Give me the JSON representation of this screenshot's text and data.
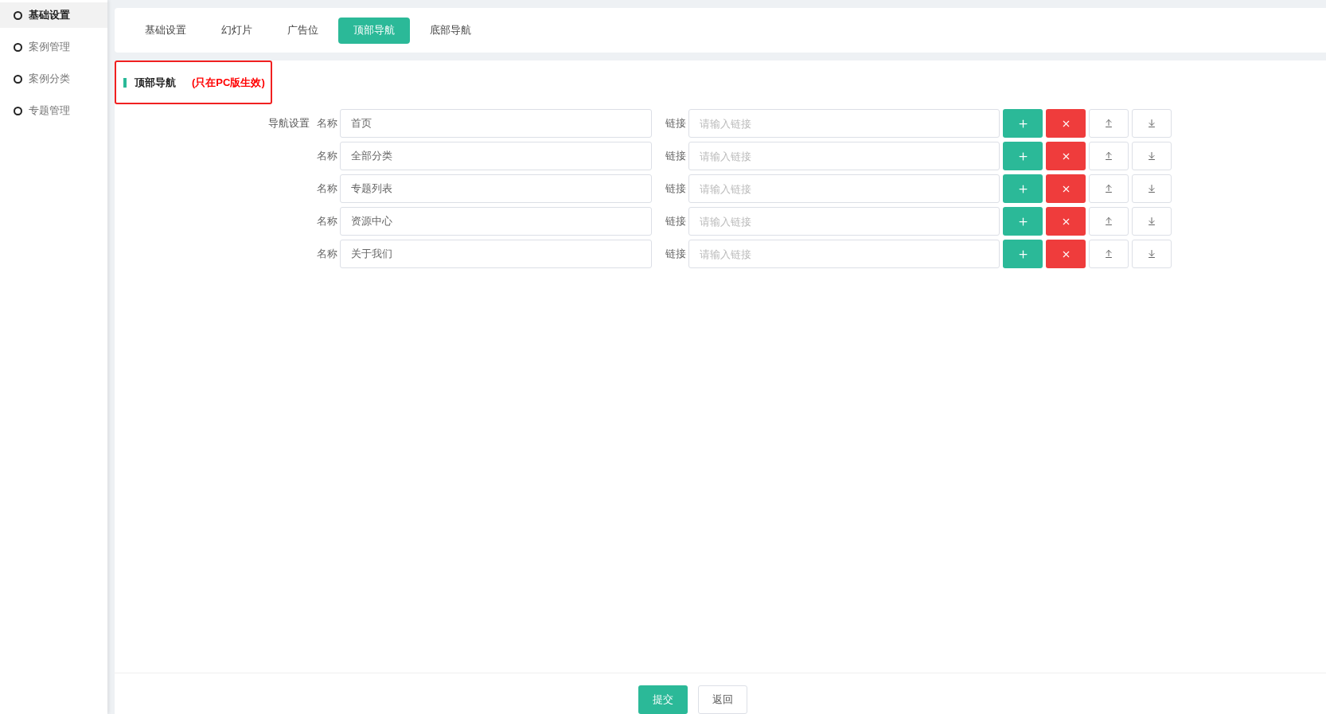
{
  "sidebar": {
    "items": [
      {
        "label": "基础设置",
        "selected": true
      },
      {
        "label": "案例管理",
        "selected": false
      },
      {
        "label": "案例分类",
        "selected": false
      },
      {
        "label": "专题管理",
        "selected": false
      }
    ]
  },
  "tabs": [
    {
      "label": "基础设置",
      "selected": false
    },
    {
      "label": "幻灯片",
      "selected": false
    },
    {
      "label": "广告位",
      "selected": false
    },
    {
      "label": "顶部导航",
      "selected": true
    },
    {
      "label": "底部导航",
      "selected": false
    }
  ],
  "section": {
    "title": "顶部导航",
    "note": "(只在PC版生效)",
    "highlighted": true
  },
  "form": {
    "label": "导航设置",
    "rows": [
      {
        "name_label": "名称",
        "name": "首页",
        "link_label": "链接",
        "link_placeholder": "请输入链接"
      },
      {
        "name_label": "名称",
        "name": "全部分类",
        "link_label": "链接",
        "link_placeholder": "请输入链接"
      },
      {
        "name_label": "名称",
        "name": "专题列表",
        "link_label": "链接",
        "link_placeholder": "请输入链接"
      },
      {
        "name_label": "名称",
        "name": "资源中心",
        "link_label": "链接",
        "link_placeholder": "请输入链接"
      },
      {
        "name_label": "名称",
        "name": "关于我们",
        "link_label": "链接",
        "link_placeholder": "请输入链接"
      }
    ]
  },
  "footer": {
    "buttons": [
      {
        "label": "提交",
        "kind": "primary"
      },
      {
        "label": "返回",
        "kind": "default"
      }
    ]
  }
}
